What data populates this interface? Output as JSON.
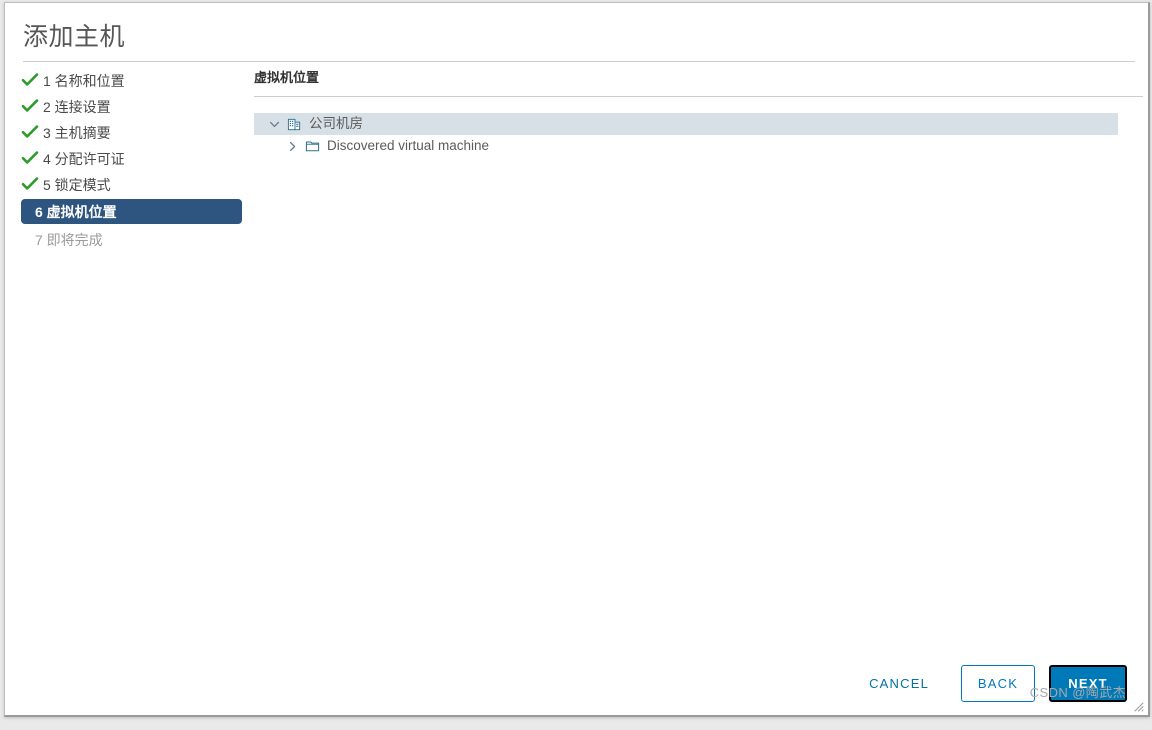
{
  "window": {
    "title": "添加主机"
  },
  "steps": [
    {
      "number": "1",
      "label": "1 名称和位置",
      "state": "done",
      "icon": "check-icon"
    },
    {
      "number": "2",
      "label": "2 连接设置",
      "state": "done",
      "icon": "check-icon"
    },
    {
      "number": "3",
      "label": "3 主机摘要",
      "state": "done",
      "icon": "check-icon"
    },
    {
      "number": "4",
      "label": "4 分配许可证",
      "state": "done",
      "icon": "check-icon"
    },
    {
      "number": "5",
      "label": "5 锁定模式",
      "state": "done",
      "icon": "check-icon"
    },
    {
      "number": "6",
      "label": "6 虚拟机位置",
      "state": "active",
      "icon": ""
    },
    {
      "number": "7",
      "label": "7 即将完成",
      "state": "pending",
      "icon": ""
    }
  ],
  "content": {
    "section_title": "虚拟机位置",
    "tree": [
      {
        "label": "公司机房",
        "icon": "datacenter-icon",
        "caret": "chevron-down-icon",
        "expanded": true,
        "selected": true,
        "level": 0
      },
      {
        "label": "Discovered virtual machine",
        "icon": "folder-icon",
        "caret": "chevron-right-icon",
        "expanded": false,
        "selected": false,
        "level": 1
      }
    ]
  },
  "footer": {
    "cancel_label": "CANCEL",
    "back_label": "BACK",
    "next_label": "NEXT"
  },
  "watermark": {
    "text": "CSDN @陶武杰"
  },
  "colors": {
    "active_step_bg": "#2d5580",
    "check_green": "#2e9b2e",
    "selected_row_bg": "#d6e0e6",
    "primary_blue": "#0079b8",
    "link_blue": "#0072a3",
    "icon_blue": "#31708f",
    "text_gray": "#5b5b5b"
  }
}
